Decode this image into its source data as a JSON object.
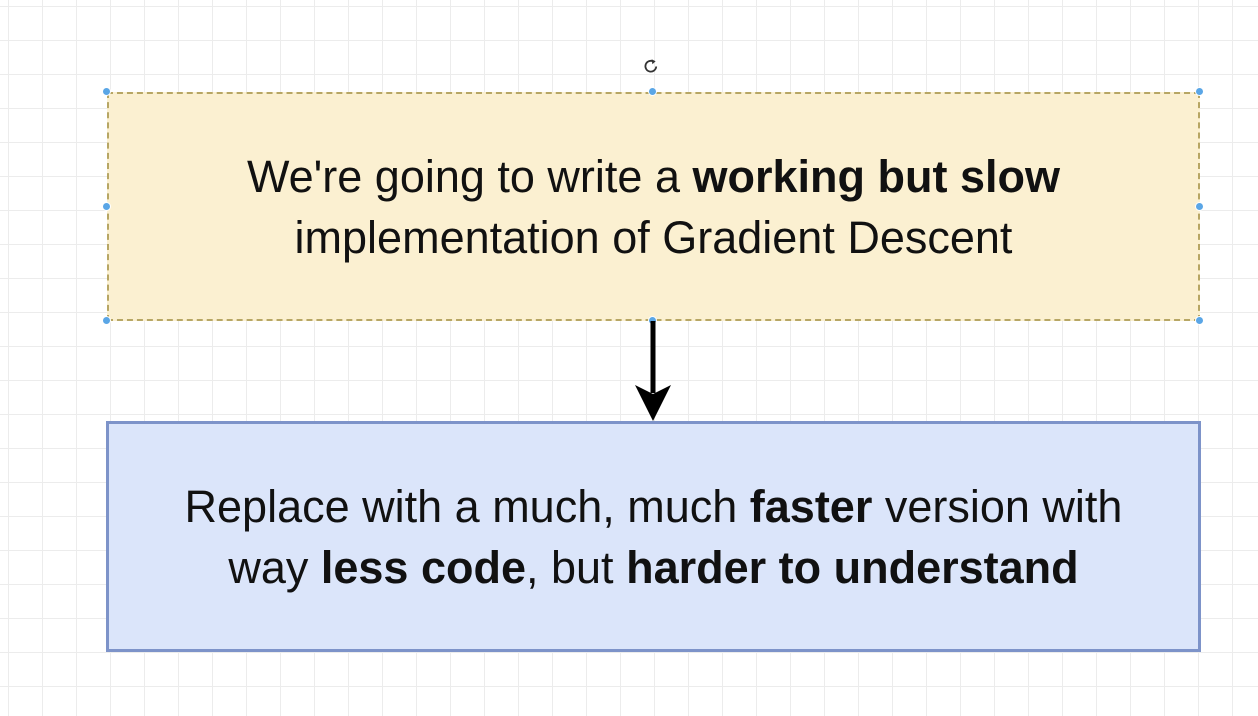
{
  "diagram": {
    "top_box": {
      "line1_prefix": "We're going to write a ",
      "line1_bold": "working but slow",
      "line2": "implementation of Gradient Descent"
    },
    "bottom_box": {
      "line1_prefix": "Replace with a much, much ",
      "line1_bold": "faster",
      "line1_suffix": " version with",
      "line2_prefix": "way ",
      "line2_bold1": "less code",
      "line2_middle": ", but ",
      "line2_bold2": "harder to understand"
    },
    "colors": {
      "top_fill": "#fbf0d1",
      "top_border": "#b7a664",
      "bottom_fill": "#dbe5fa",
      "bottom_border": "#7d93c9",
      "selection_handle": "#5aa6e6",
      "arrow": "#000000"
    },
    "icons": {
      "rotate": "rotate-icon",
      "arrow": "arrow-down"
    }
  }
}
